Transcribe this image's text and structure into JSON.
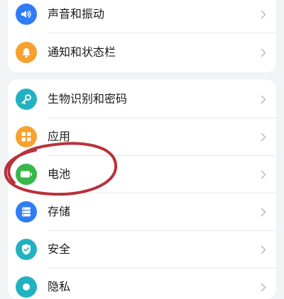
{
  "group_notifications": {
    "items": [
      {
        "label": "声音和振动",
        "icon": "speaker-icon",
        "color": "#2f7cf6"
      },
      {
        "label": "通知和状态栏",
        "icon": "bell-icon",
        "color": "#f7a12e"
      }
    ]
  },
  "group_system": {
    "items": [
      {
        "label": "生物识别和密码",
        "icon": "key-icon",
        "color": "#21b2c1"
      },
      {
        "label": "应用",
        "icon": "apps-grid-icon",
        "color": "#f7a12e"
      },
      {
        "label": "电池",
        "icon": "battery-icon",
        "color": "#37b74a"
      },
      {
        "label": "存储",
        "icon": "storage-icon",
        "color": "#2f7cf6"
      },
      {
        "label": "安全",
        "icon": "shield-check-icon",
        "color": "#21b2c1"
      },
      {
        "label": "隐私",
        "icon": "privacy-icon",
        "color": "#21b2c1"
      }
    ]
  },
  "annotation": {
    "color": "#b8323c",
    "target": "电池"
  }
}
